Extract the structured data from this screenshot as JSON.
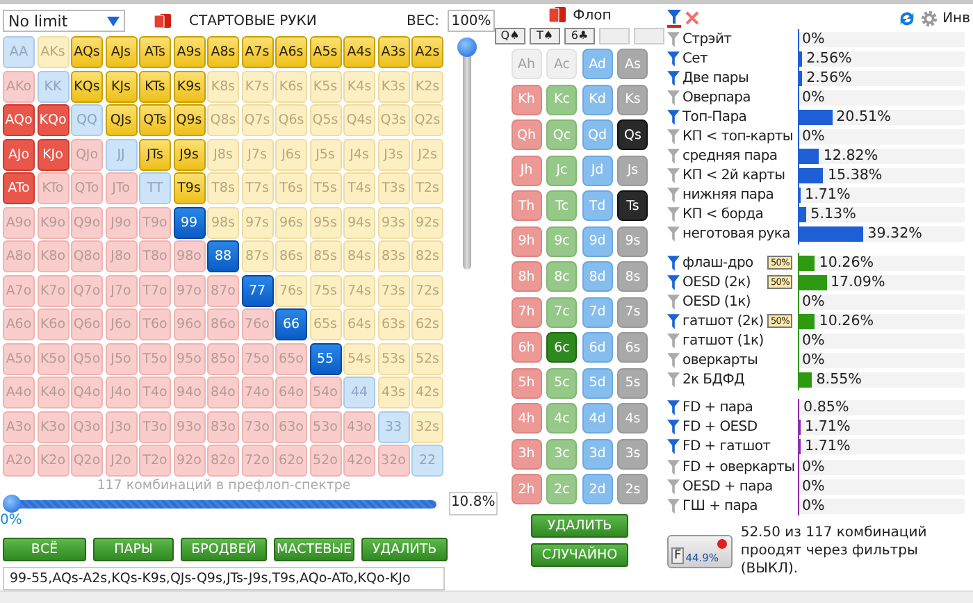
{
  "game_select": {
    "value": "No limit"
  },
  "hands_header": {
    "title": "СТАРТОВЫЕ РУКИ",
    "weight_label": "ВЕС:",
    "weight_value": "100%"
  },
  "weight_slider": {
    "level": 1
  },
  "hand_grid": [
    [
      {
        "label": "AA",
        "selected": false
      },
      {
        "label": "AKs",
        "selected": false
      },
      {
        "label": "AQs",
        "selected": true
      },
      {
        "label": "AJs",
        "selected": true
      },
      {
        "label": "ATs",
        "selected": true
      },
      {
        "label": "A9s",
        "selected": true
      },
      {
        "label": "A8s",
        "selected": true
      },
      {
        "label": "A7s",
        "selected": true
      },
      {
        "label": "A6s",
        "selected": true
      },
      {
        "label": "A5s",
        "selected": true
      },
      {
        "label": "A4s",
        "selected": true
      },
      {
        "label": "A3s",
        "selected": true
      },
      {
        "label": "A2s",
        "selected": true
      }
    ],
    [
      {
        "label": "AKo",
        "selected": false
      },
      {
        "label": "KK",
        "selected": false
      },
      {
        "label": "KQs",
        "selected": true
      },
      {
        "label": "KJs",
        "selected": true
      },
      {
        "label": "KTs",
        "selected": true
      },
      {
        "label": "K9s",
        "selected": true
      },
      {
        "label": "K8s",
        "selected": false
      },
      {
        "label": "K7s",
        "selected": false
      },
      {
        "label": "K6s",
        "selected": false
      },
      {
        "label": "K5s",
        "selected": false
      },
      {
        "label": "K4s",
        "selected": false
      },
      {
        "label": "K3s",
        "selected": false
      },
      {
        "label": "K2s",
        "selected": false
      }
    ],
    [
      {
        "label": "AQo",
        "selected": true
      },
      {
        "label": "KQo",
        "selected": true
      },
      {
        "label": "QQ",
        "selected": false
      },
      {
        "label": "QJs",
        "selected": true
      },
      {
        "label": "QTs",
        "selected": true
      },
      {
        "label": "Q9s",
        "selected": true
      },
      {
        "label": "Q8s",
        "selected": false
      },
      {
        "label": "Q7s",
        "selected": false
      },
      {
        "label": "Q6s",
        "selected": false
      },
      {
        "label": "Q5s",
        "selected": false
      },
      {
        "label": "Q4s",
        "selected": false
      },
      {
        "label": "Q3s",
        "selected": false
      },
      {
        "label": "Q2s",
        "selected": false
      }
    ],
    [
      {
        "label": "AJo",
        "selected": true
      },
      {
        "label": "KJo",
        "selected": true
      },
      {
        "label": "QJo",
        "selected": false
      },
      {
        "label": "JJ",
        "selected": false
      },
      {
        "label": "JTs",
        "selected": true
      },
      {
        "label": "J9s",
        "selected": true
      },
      {
        "label": "J8s",
        "selected": false
      },
      {
        "label": "J7s",
        "selected": false
      },
      {
        "label": "J6s",
        "selected": false
      },
      {
        "label": "J5s",
        "selected": false
      },
      {
        "label": "J4s",
        "selected": false
      },
      {
        "label": "J3s",
        "selected": false
      },
      {
        "label": "J2s",
        "selected": false
      }
    ],
    [
      {
        "label": "ATo",
        "selected": true
      },
      {
        "label": "KTo",
        "selected": false
      },
      {
        "label": "QTo",
        "selected": false
      },
      {
        "label": "JTo",
        "selected": false
      },
      {
        "label": "TT",
        "selected": false
      },
      {
        "label": "T9s",
        "selected": true
      },
      {
        "label": "T8s",
        "selected": false
      },
      {
        "label": "T7s",
        "selected": false
      },
      {
        "label": "T6s",
        "selected": false
      },
      {
        "label": "T5s",
        "selected": false
      },
      {
        "label": "T4s",
        "selected": false
      },
      {
        "label": "T3s",
        "selected": false
      },
      {
        "label": "T2s",
        "selected": false
      }
    ],
    [
      {
        "label": "A9o",
        "selected": false
      },
      {
        "label": "K9o",
        "selected": false
      },
      {
        "label": "Q9o",
        "selected": false
      },
      {
        "label": "J9o",
        "selected": false
      },
      {
        "label": "T9o",
        "selected": false
      },
      {
        "label": "99",
        "selected": true
      },
      {
        "label": "98s",
        "selected": false
      },
      {
        "label": "97s",
        "selected": false
      },
      {
        "label": "96s",
        "selected": false
      },
      {
        "label": "95s",
        "selected": false
      },
      {
        "label": "94s",
        "selected": false
      },
      {
        "label": "93s",
        "selected": false
      },
      {
        "label": "92s",
        "selected": false
      }
    ],
    [
      {
        "label": "A8o",
        "selected": false
      },
      {
        "label": "K8o",
        "selected": false
      },
      {
        "label": "Q8o",
        "selected": false
      },
      {
        "label": "J8o",
        "selected": false
      },
      {
        "label": "T8o",
        "selected": false
      },
      {
        "label": "98o",
        "selected": false
      },
      {
        "label": "88",
        "selected": true
      },
      {
        "label": "87s",
        "selected": false
      },
      {
        "label": "86s",
        "selected": false
      },
      {
        "label": "85s",
        "selected": false
      },
      {
        "label": "84s",
        "selected": false
      },
      {
        "label": "83s",
        "selected": false
      },
      {
        "label": "82s",
        "selected": false
      }
    ],
    [
      {
        "label": "A7o",
        "selected": false
      },
      {
        "label": "K7o",
        "selected": false
      },
      {
        "label": "Q7o",
        "selected": false
      },
      {
        "label": "J7o",
        "selected": false
      },
      {
        "label": "T7o",
        "selected": false
      },
      {
        "label": "97o",
        "selected": false
      },
      {
        "label": "87o",
        "selected": false
      },
      {
        "label": "77",
        "selected": true
      },
      {
        "label": "76s",
        "selected": false
      },
      {
        "label": "75s",
        "selected": false
      },
      {
        "label": "74s",
        "selected": false
      },
      {
        "label": "73s",
        "selected": false
      },
      {
        "label": "72s",
        "selected": false
      }
    ],
    [
      {
        "label": "A6o",
        "selected": false
      },
      {
        "label": "K6o",
        "selected": false
      },
      {
        "label": "Q6o",
        "selected": false
      },
      {
        "label": "J6o",
        "selected": false
      },
      {
        "label": "T6o",
        "selected": false
      },
      {
        "label": "96o",
        "selected": false
      },
      {
        "label": "86o",
        "selected": false
      },
      {
        "label": "76o",
        "selected": false
      },
      {
        "label": "66",
        "selected": true
      },
      {
        "label": "65s",
        "selected": false
      },
      {
        "label": "64s",
        "selected": false
      },
      {
        "label": "63s",
        "selected": false
      },
      {
        "label": "62s",
        "selected": false
      }
    ],
    [
      {
        "label": "A5o",
        "selected": false
      },
      {
        "label": "K5o",
        "selected": false
      },
      {
        "label": "Q5o",
        "selected": false
      },
      {
        "label": "J5o",
        "selected": false
      },
      {
        "label": "T5o",
        "selected": false
      },
      {
        "label": "95o",
        "selected": false
      },
      {
        "label": "85o",
        "selected": false
      },
      {
        "label": "75o",
        "selected": false
      },
      {
        "label": "65o",
        "selected": false
      },
      {
        "label": "55",
        "selected": true
      },
      {
        "label": "54s",
        "selected": false
      },
      {
        "label": "53s",
        "selected": false
      },
      {
        "label": "52s",
        "selected": false
      }
    ],
    [
      {
        "label": "A4o",
        "selected": false
      },
      {
        "label": "K4o",
        "selected": false
      },
      {
        "label": "Q4o",
        "selected": false
      },
      {
        "label": "J4o",
        "selected": false
      },
      {
        "label": "T4o",
        "selected": false
      },
      {
        "label": "94o",
        "selected": false
      },
      {
        "label": "84o",
        "selected": false
      },
      {
        "label": "74o",
        "selected": false
      },
      {
        "label": "64o",
        "selected": false
      },
      {
        "label": "54o",
        "selected": false
      },
      {
        "label": "44",
        "selected": false
      },
      {
        "label": "43s",
        "selected": false
      },
      {
        "label": "42s",
        "selected": false
      }
    ],
    [
      {
        "label": "A3o",
        "selected": false
      },
      {
        "label": "K3o",
        "selected": false
      },
      {
        "label": "Q3o",
        "selected": false
      },
      {
        "label": "J3o",
        "selected": false
      },
      {
        "label": "T3o",
        "selected": false
      },
      {
        "label": "93o",
        "selected": false
      },
      {
        "label": "83o",
        "selected": false
      },
      {
        "label": "73o",
        "selected": false
      },
      {
        "label": "63o",
        "selected": false
      },
      {
        "label": "53o",
        "selected": false
      },
      {
        "label": "43o",
        "selected": false
      },
      {
        "label": "33",
        "selected": false
      },
      {
        "label": "32s",
        "selected": false
      }
    ],
    [
      {
        "label": "A2o",
        "selected": false
      },
      {
        "label": "K2o",
        "selected": false
      },
      {
        "label": "Q2o",
        "selected": false
      },
      {
        "label": "J2o",
        "selected": false
      },
      {
        "label": "T2o",
        "selected": false
      },
      {
        "label": "92o",
        "selected": false
      },
      {
        "label": "82o",
        "selected": false
      },
      {
        "label": "72o",
        "selected": false
      },
      {
        "label": "62o",
        "selected": false
      },
      {
        "label": "52o",
        "selected": false
      },
      {
        "label": "42o",
        "selected": false
      },
      {
        "label": "32o",
        "selected": false
      },
      {
        "label": "22",
        "selected": false
      }
    ]
  ],
  "combo_caption": "117 комбинаций в префлоп-спектре",
  "range_slider": {
    "level": 0,
    "min_label": "0%",
    "value": "10.8%"
  },
  "range_buttons": [
    "ВСЁ",
    "ПАРЫ",
    "БРОДВЕЙ",
    "МАСТЕВЫЕ",
    "УДАЛИТЬ"
  ],
  "range_text": "99-55,AQs-A2s,KQs-K9s,QJs-Q9s,JTs-J9s,T9s,AQo-ATo,KQo-KJo",
  "flop": {
    "title": "Флоп",
    "board": [
      "Q♠",
      "T♠",
      "6♣"
    ]
  },
  "card_grid": [
    [
      {
        "label": "Ah",
        "on_board": false,
        "disabled": true
      },
      {
        "label": "Ac",
        "on_board": false,
        "disabled": true
      },
      {
        "label": "Ad",
        "on_board": false,
        "disabled": false
      },
      {
        "label": "As",
        "on_board": false,
        "disabled": false
      }
    ],
    [
      {
        "label": "Kh",
        "on_board": false,
        "disabled": false
      },
      {
        "label": "Kc",
        "on_board": false,
        "disabled": false
      },
      {
        "label": "Kd",
        "on_board": false,
        "disabled": false
      },
      {
        "label": "Ks",
        "on_board": false,
        "disabled": false
      }
    ],
    [
      {
        "label": "Qh",
        "on_board": false,
        "disabled": false
      },
      {
        "label": "Qc",
        "on_board": false,
        "disabled": false
      },
      {
        "label": "Qd",
        "on_board": false,
        "disabled": false
      },
      {
        "label": "Qs",
        "on_board": true,
        "disabled": false
      }
    ],
    [
      {
        "label": "Jh",
        "on_board": false,
        "disabled": false
      },
      {
        "label": "Jc",
        "on_board": false,
        "disabled": false
      },
      {
        "label": "Jd",
        "on_board": false,
        "disabled": false
      },
      {
        "label": "Js",
        "on_board": false,
        "disabled": false
      }
    ],
    [
      {
        "label": "Th",
        "on_board": false,
        "disabled": false
      },
      {
        "label": "Tc",
        "on_board": false,
        "disabled": false
      },
      {
        "label": "Td",
        "on_board": false,
        "disabled": false
      },
      {
        "label": "Ts",
        "on_board": true,
        "disabled": false
      }
    ],
    [
      {
        "label": "9h",
        "on_board": false,
        "disabled": false
      },
      {
        "label": "9c",
        "on_board": false,
        "disabled": false
      },
      {
        "label": "9d",
        "on_board": false,
        "disabled": false
      },
      {
        "label": "9s",
        "on_board": false,
        "disabled": false
      }
    ],
    [
      {
        "label": "8h",
        "on_board": false,
        "disabled": false
      },
      {
        "label": "8c",
        "on_board": false,
        "disabled": false
      },
      {
        "label": "8d",
        "on_board": false,
        "disabled": false
      },
      {
        "label": "8s",
        "on_board": false,
        "disabled": false
      }
    ],
    [
      {
        "label": "7h",
        "on_board": false,
        "disabled": false
      },
      {
        "label": "7c",
        "on_board": false,
        "disabled": false
      },
      {
        "label": "7d",
        "on_board": false,
        "disabled": false
      },
      {
        "label": "7s",
        "on_board": false,
        "disabled": false
      }
    ],
    [
      {
        "label": "6h",
        "on_board": false,
        "disabled": false
      },
      {
        "label": "6c",
        "on_board": true,
        "disabled": false
      },
      {
        "label": "6d",
        "on_board": false,
        "disabled": false
      },
      {
        "label": "6s",
        "on_board": false,
        "disabled": false
      }
    ],
    [
      {
        "label": "5h",
        "on_board": false,
        "disabled": false
      },
      {
        "label": "5c",
        "on_board": false,
        "disabled": false
      },
      {
        "label": "5d",
        "on_board": false,
        "disabled": false
      },
      {
        "label": "5s",
        "on_board": false,
        "disabled": false
      }
    ],
    [
      {
        "label": "4h",
        "on_board": false,
        "disabled": false
      },
      {
        "label": "4c",
        "on_board": false,
        "disabled": false
      },
      {
        "label": "4d",
        "on_board": false,
        "disabled": false
      },
      {
        "label": "4s",
        "on_board": false,
        "disabled": false
      }
    ],
    [
      {
        "label": "3h",
        "on_board": false,
        "disabled": false
      },
      {
        "label": "3c",
        "on_board": false,
        "disabled": false
      },
      {
        "label": "3d",
        "on_board": false,
        "disabled": false
      },
      {
        "label": "3s",
        "on_board": false,
        "disabled": false
      }
    ],
    [
      {
        "label": "2h",
        "on_board": false,
        "disabled": false
      },
      {
        "label": "2c",
        "on_board": false,
        "disabled": false
      },
      {
        "label": "2d",
        "on_board": false,
        "disabled": false
      },
      {
        "label": "2s",
        "on_board": false,
        "disabled": false
      }
    ]
  ],
  "card_buttons": [
    "УДАЛИТЬ",
    "СЛУЧАЙНО"
  ],
  "filters_toolbar": {
    "invert_label": "Инв"
  },
  "filter_groups": [
    {
      "color": "#1f5fd6",
      "rows": [
        {
          "label": "Стрэйт",
          "active": false,
          "level": 0,
          "value": "0%"
        },
        {
          "label": "Сет",
          "active": true,
          "level": 0.0256,
          "value": "2.56%"
        },
        {
          "label": "Две пары",
          "active": true,
          "level": 0.0256,
          "value": "2.56%"
        },
        {
          "label": "Оверпара",
          "active": false,
          "level": 0,
          "value": "0%"
        },
        {
          "label": "Топ-Пара",
          "active": true,
          "level": 0.2051,
          "value": "20.51%"
        },
        {
          "label": "КП < топ-карты",
          "active": false,
          "level": 0,
          "value": "0%"
        },
        {
          "label": "средняя пара",
          "active": false,
          "level": 0.1282,
          "value": "12.82%"
        },
        {
          "label": "КП < 2й карты",
          "active": false,
          "level": 0.1538,
          "value": "15.38%"
        },
        {
          "label": "нижняя пара",
          "active": false,
          "level": 0.0171,
          "value": "1.71%"
        },
        {
          "label": "КП < борда",
          "active": false,
          "level": 0.0513,
          "value": "5.13%"
        },
        {
          "label": "неготовая рука",
          "active": false,
          "level": 0.3932,
          "value": "39.32%"
        }
      ]
    },
    {
      "color": "#2e9a12",
      "rows": [
        {
          "label": "флаш-дро",
          "active": true,
          "badge": "50%",
          "level": 0.1026,
          "value": "10.26%"
        },
        {
          "label": "OESD (2к)",
          "active": true,
          "badge": "50%",
          "level": 0.1709,
          "value": "17.09%"
        },
        {
          "label": "OESD (1к)",
          "active": false,
          "level": 0,
          "value": "0%"
        },
        {
          "label": "гатшот (2к)",
          "active": true,
          "badge": "50%",
          "level": 0.1026,
          "value": "10.26%"
        },
        {
          "label": "гатшот (1к)",
          "active": false,
          "level": 0,
          "value": "0%"
        },
        {
          "label": "оверкарты",
          "active": false,
          "level": 0,
          "value": "0%"
        },
        {
          "label": "2к БДФД",
          "active": false,
          "level": 0.0855,
          "value": "8.55%"
        }
      ]
    },
    {
      "color": "#8e2bb0",
      "rows": [
        {
          "label": "FD + пара",
          "active": true,
          "level": 0.0085,
          "value": "0.85%"
        },
        {
          "label": "FD + OESD",
          "active": true,
          "level": 0.0171,
          "value": "1.71%"
        },
        {
          "label": "FD + гатшот",
          "active": true,
          "level": 0.0171,
          "value": "1.71%"
        },
        {
          "label": "FD + оверкарты",
          "active": false,
          "level": 0,
          "value": "0%"
        },
        {
          "label": "OESD + пара",
          "active": false,
          "level": 0,
          "value": "0%"
        },
        {
          "label": "ГШ + пара",
          "active": false,
          "level": 0,
          "value": "0%"
        }
      ]
    }
  ],
  "filter_button": {
    "letter": "F",
    "value": "44.9%"
  },
  "filter_summary": {
    "line1": "52.50 из 117 комбинаций",
    "line2": "проодят через фильтры (ВЫКЛ)."
  }
}
